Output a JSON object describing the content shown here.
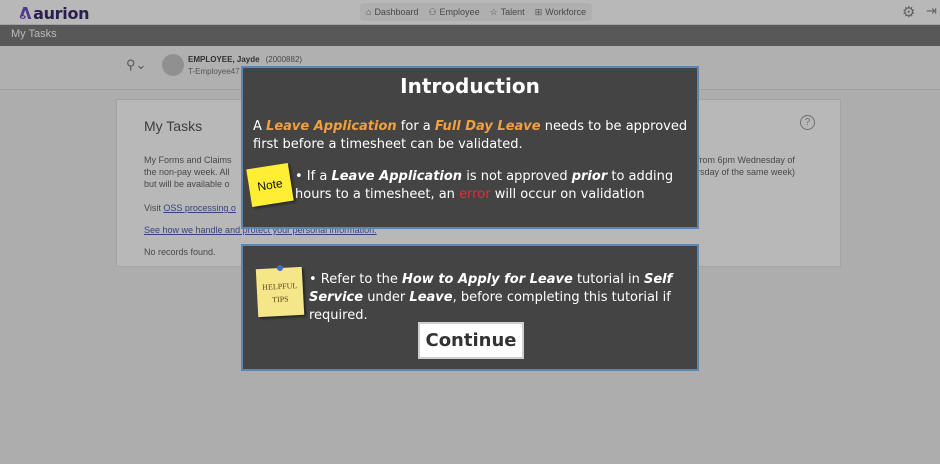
{
  "app": {
    "logo_text": "aurion",
    "logo_mark": "ᕕ"
  },
  "nav": {
    "items": [
      {
        "label": "Dashboard",
        "icon": "home-icon"
      },
      {
        "label": "Employee",
        "icon": "people-icon"
      },
      {
        "label": "Talent",
        "icon": "star-icon"
      },
      {
        "label": "Workforce",
        "icon": "chart-icon"
      }
    ]
  },
  "page": {
    "title": "My Tasks"
  },
  "employee": {
    "name": "EMPLOYEE, Jayde",
    "id": "(2000882)",
    "sub": "T-Employee47"
  },
  "card": {
    "title": "My Tasks",
    "line1a": "My Forms and Claims",
    "line1b": "from 6pm Wednesday of",
    "line2a": "the non-pay week. All",
    "line2b": "rsday of the same week)",
    "line3": "but will be available o",
    "visit": "Visit",
    "visit_link": "OSS processing o",
    "privacy_link": "See how we handle and protect your personal information.",
    "no_records": "No records found."
  },
  "modal1": {
    "title": "Introduction",
    "intro_a": "A",
    "intro_b": "Leave Application",
    "intro_c": "for a",
    "intro_d": "Full Day Leave",
    "intro_e": "needs to be approved first before a timesheet can be validated.",
    "note_label": "Note",
    "note_a": "• If a",
    "note_b": "Leave Application",
    "note_c": "is not approved",
    "note_d": "prior",
    "note_e": "to adding hours to a timesheet, an",
    "note_f": "error",
    "note_g": "will occur on validation"
  },
  "modal2": {
    "tips_label_1": "HELPFUL",
    "tips_label_2": "TIPS",
    "tips_a": "• Refer to the",
    "tips_b": "How to Apply for Leave",
    "tips_c": "tutorial in",
    "tips_d": "Self Service",
    "tips_e": "under",
    "tips_f": "Leave",
    "tips_g": ", before completing this tutorial if required.",
    "continue_label": "Continue"
  },
  "colors": {
    "modal_bg": "#444444",
    "modal_border": "#5a87b5",
    "highlight": "#f0a040",
    "error": "#e03030",
    "note_sticky": "#ffee33",
    "tips_sticky": "#f6e68a"
  }
}
